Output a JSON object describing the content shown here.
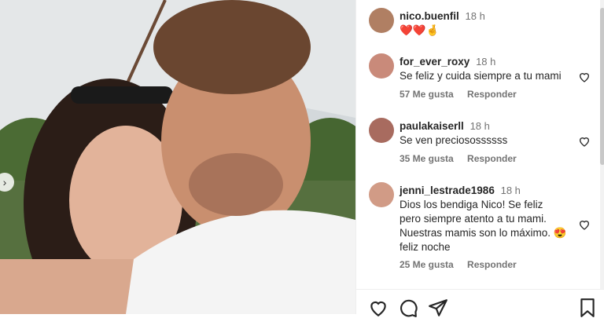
{
  "post": {
    "author": "nico.buenfil",
    "time": "18 h",
    "caption": "❤️❤️🤞"
  },
  "comments": [
    {
      "user": "for_ever_roxy",
      "time": "18 h",
      "text": "Se feliz y cuida siempre a tu mami",
      "likes": "57 Me gusta",
      "reply": "Responder"
    },
    {
      "user": "paulakaiserll",
      "time": "18 h",
      "text": "Se ven preciosossssss",
      "likes": "35 Me gusta",
      "reply": "Responder"
    },
    {
      "user": "jenni_lestrade1986",
      "time": "18 h",
      "text": "Dios los bendiga Nico! Se feliz pero siempre atento a tu mami. Nuestras mamis son lo máximo. 😍 feliz noche",
      "likes": "25 Me gusta",
      "reply": "Responder"
    }
  ],
  "actions": {
    "like": "heart-icon",
    "comment": "comment-icon",
    "share": "share-icon",
    "save": "bookmark-icon"
  },
  "colors": {
    "text": "#262626",
    "muted": "#737373",
    "heart": "#ed4956"
  }
}
